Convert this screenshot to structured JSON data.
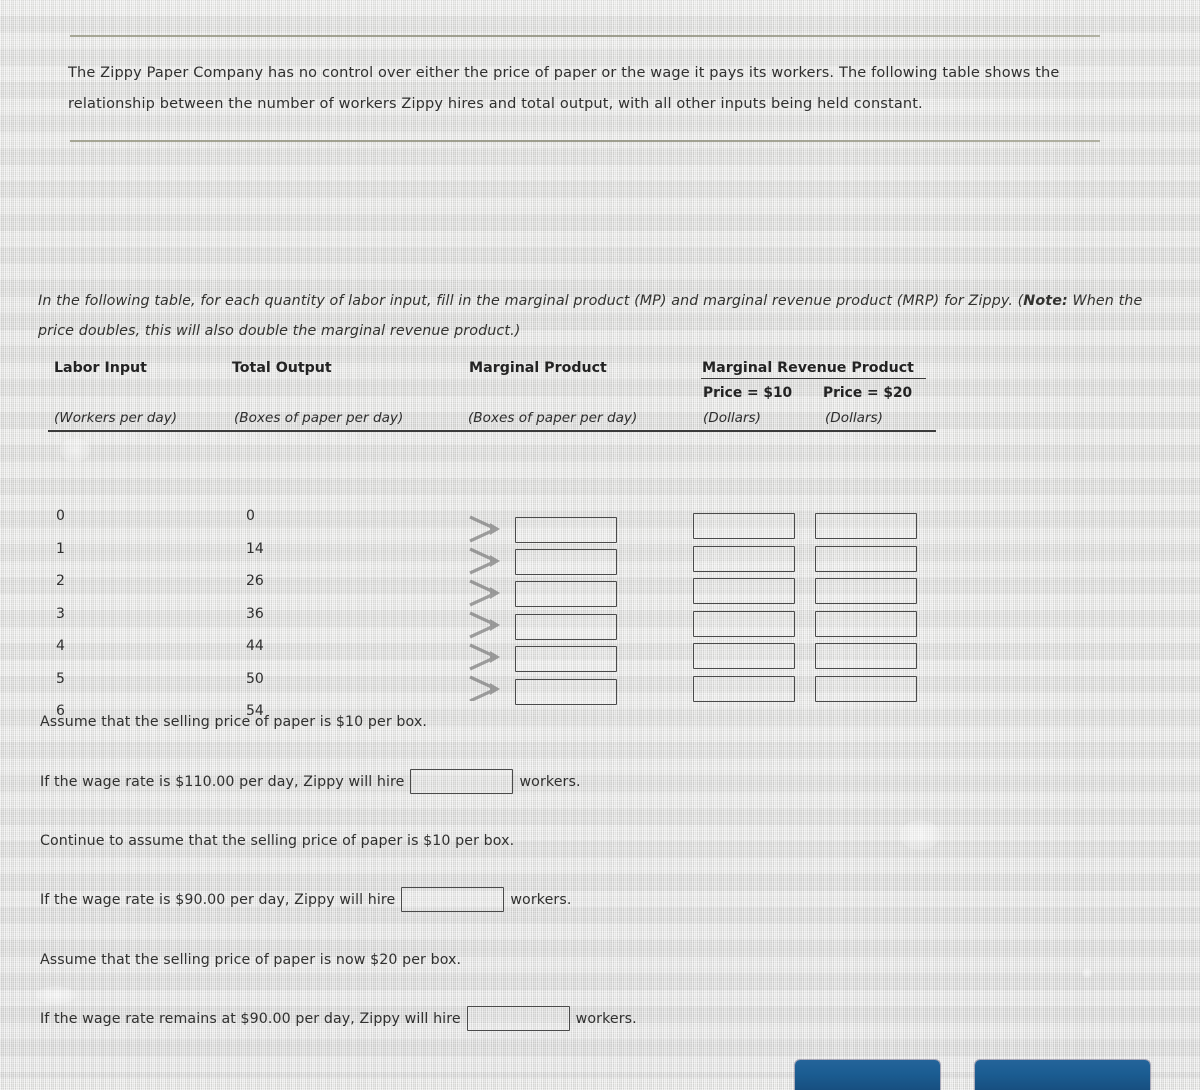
{
  "intro": {
    "paragraph": "The Zippy Paper Company has no control over either the price of paper or the wage it pays its workers. The following table shows the relationship between the number of workers Zippy hires and total output, with all other inputs being held constant."
  },
  "instruction": {
    "text_before_note": "In the following table, for each quantity of labor input, fill in the marginal product (MP) and marginal revenue product (MRP) for Zippy. (",
    "note_label": "Note:",
    "text_after_note": " When the price doubles, this will also double the marginal revenue product.)"
  },
  "table": {
    "headers": {
      "labor_input": "Labor Input",
      "total_output": "Total Output",
      "marginal_product": "Marginal Product",
      "marginal_revenue_product": "Marginal Revenue Product",
      "price_10": "Price = $10",
      "price_20": "Price = $20"
    },
    "subheaders": {
      "labor_input": "(Workers per day)",
      "total_output": "(Boxes of paper per day)",
      "marginal_product": "(Boxes of paper per day)",
      "dollars_10": "(Dollars)",
      "dollars_20": "(Dollars)"
    },
    "rows": [
      {
        "labor": "0",
        "output": "0"
      },
      {
        "labor": "1",
        "output": "14"
      },
      {
        "labor": "2",
        "output": "26"
      },
      {
        "labor": "3",
        "output": "36"
      },
      {
        "labor": "4",
        "output": "44"
      },
      {
        "labor": "5",
        "output": "50"
      },
      {
        "labor": "6",
        "output": "54"
      }
    ],
    "input_rows": [
      {
        "mp": "",
        "mrp10": "",
        "mrp20": ""
      },
      {
        "mp": "",
        "mrp10": "",
        "mrp20": ""
      },
      {
        "mp": "",
        "mrp10": "",
        "mrp20": ""
      },
      {
        "mp": "",
        "mrp10": "",
        "mrp20": ""
      },
      {
        "mp": "",
        "mrp10": "",
        "mrp20": ""
      },
      {
        "mp": "",
        "mrp10": "",
        "mrp20": ""
      }
    ]
  },
  "questions": [
    {
      "assumption": "Assume that the selling price of paper is $10 per box.",
      "prompt_prefix": "If the wage rate is $110.00 per day, Zippy will hire",
      "answer_value": "",
      "prompt_suffix": "workers."
    },
    {
      "assumption": "Continue to assume that the selling price of paper is $10 per box.",
      "prompt_prefix": "If the wage rate is $90.00 per day, Zippy will hire",
      "answer_value": "",
      "prompt_suffix": "workers."
    },
    {
      "assumption": "Assume that the selling price of paper is now $20 per box.",
      "prompt_prefix": "If the wage rate remains at $90.00 per day, Zippy will hire",
      "answer_value": "",
      "prompt_suffix": "workers."
    }
  ],
  "footer": {
    "primary_button_label": "",
    "secondary_button_label": ""
  },
  "colors": {
    "button_blue": "#1b5d92",
    "page_background": "#e2e2e0",
    "rule_gold": "#9a9a86",
    "text": "#30302f"
  }
}
